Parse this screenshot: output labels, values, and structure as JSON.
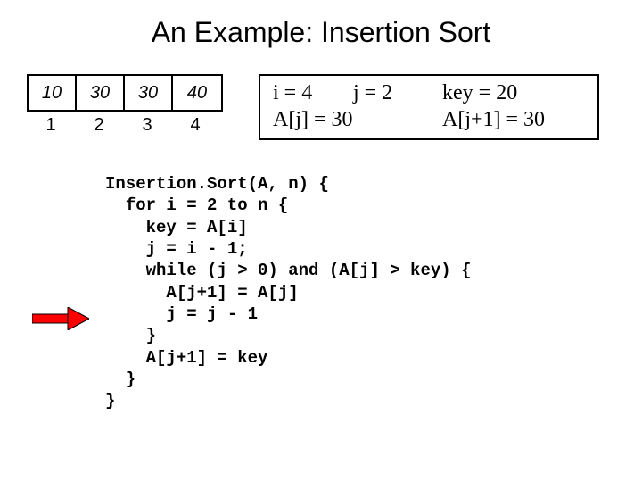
{
  "title": "An Example: Insertion Sort",
  "array": {
    "cells": [
      "10",
      "30",
      "30",
      "40"
    ],
    "indices": [
      "1",
      "2",
      "3",
      "4"
    ]
  },
  "state": {
    "i_label": "i = 4",
    "j_label": "j = 2",
    "key_label": "key = 20",
    "aj_label": "A[j] = 30",
    "ajp1_label": "A[j+1] = 30"
  },
  "code": {
    "l0": "Insertion.Sort(A, n) {",
    "l1": "  for i = 2 to n {",
    "l2": "    key = A[i]",
    "l3": "    j = i - 1;",
    "l4": "    while (j > 0) and (A[j] > key) {",
    "l5": "      A[j+1] = A[j]",
    "l6": "      j = j - 1",
    "l7": "    }",
    "l8": "    A[j+1] = key",
    "l9": "  }",
    "l10": "}"
  }
}
